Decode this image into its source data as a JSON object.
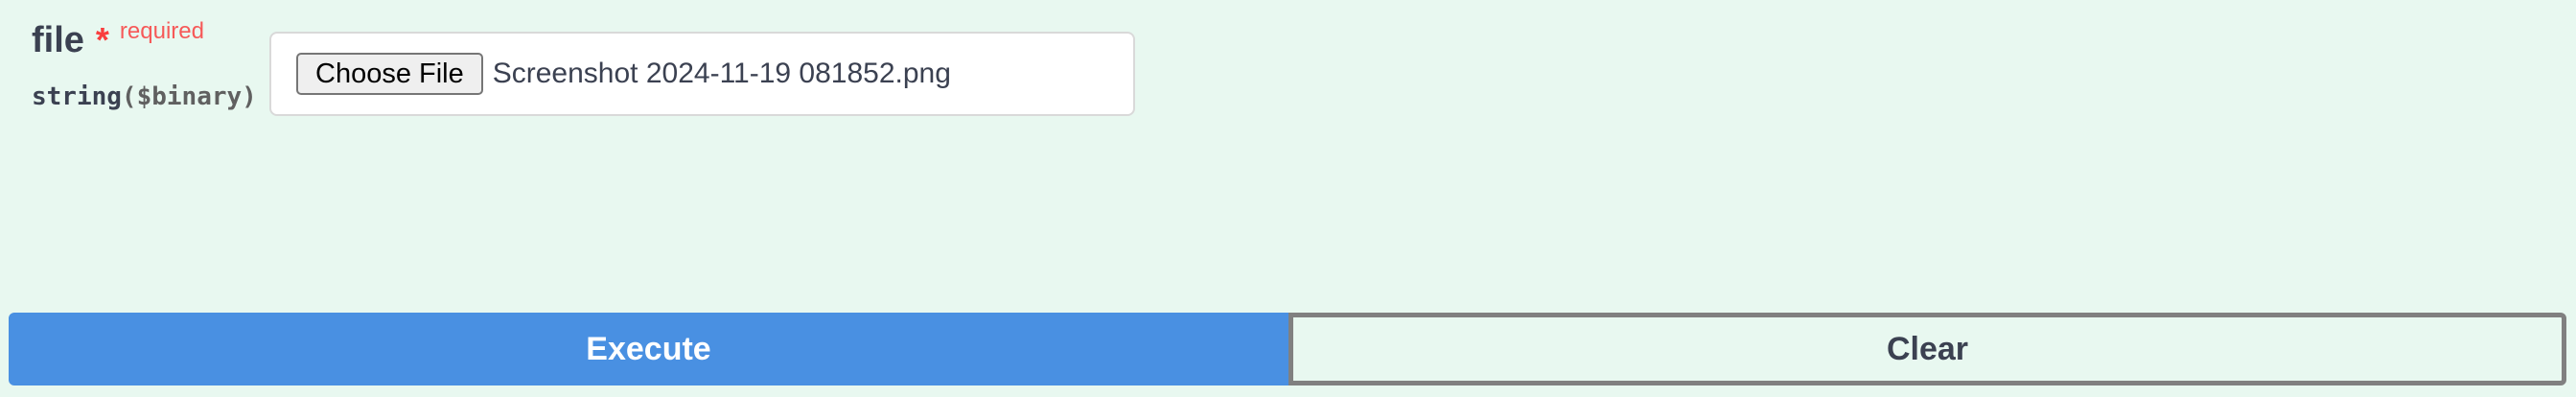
{
  "parameter": {
    "name": "file",
    "required_marker": "*",
    "required_label": "required",
    "type_prefix": "string",
    "type_format": "($binary)"
  },
  "file_input": {
    "button_label": "Choose File",
    "selected_file": "Screenshot 2024-11-19 081852.png"
  },
  "actions": {
    "execute_label": "Execute",
    "clear_label": "Clear"
  },
  "colors": {
    "background": "#e8f8f0",
    "execute": "#4990e2",
    "required": "#f93e3e",
    "text": "#3b4151"
  }
}
